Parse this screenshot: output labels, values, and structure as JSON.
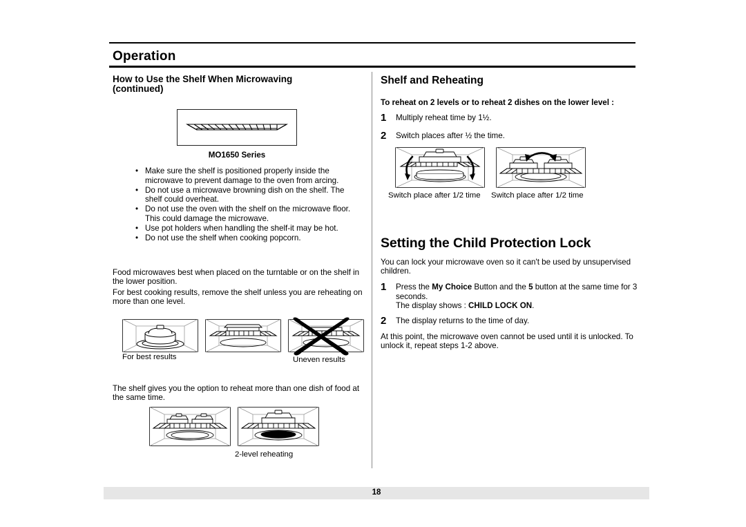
{
  "header": {
    "section_title": "Operation"
  },
  "left_column": {
    "heading_line1": "How to Use the Shelf When Microwaving",
    "heading_line2": "(continued)",
    "figure_shelf_caption": "MO1650 Series",
    "bullet_marker": "•",
    "bullets": [
      "Make sure the shelf is positioned properly inside the microwave to prevent damage to the oven from arcing.",
      "Do not use a microwave browning dish on the shelf. The shelf could overheat.",
      "Do not use the oven with the shelf on the microwave floor. This could damage the microwave.",
      "Use pot holders when handling the shelf-it may be hot.",
      "Do not use the shelf when cooking popcorn."
    ],
    "paragraph_1": "Food microwaves best when placed on the turntable or on the shelf in the lower position.",
    "paragraph_2": "For best cooking results, remove the shelf unless you are reheating on more than one level.",
    "caption_best_results": "For best results",
    "caption_uneven_results": "Uneven results",
    "paragraph_3": "The shelf gives you the option to reheat more than one dish of food at the same time.",
    "caption_two_level": "2-level reheating"
  },
  "right_column": {
    "heading_shelf_reheating": "Shelf and Reheating",
    "subheading": "To reheat on 2 levels or to reheat 2 dishes on the lower level :",
    "steps": [
      {
        "number": "1",
        "text": "Multiply reheat time by 1½."
      },
      {
        "number": "2",
        "text": "Switch places after ½ the time."
      }
    ],
    "caption_switch_left": "Switch place after 1/2 time",
    "caption_switch_right": "Switch place after 1/2 time",
    "heading_child_lock": "Setting the Child Protection Lock",
    "lock_intro": "You can lock your microwave oven so it can't be used by unsupervised children.",
    "lock_step1_number": "1",
    "lock_step1_part1": "Press the ",
    "lock_step1_bold1": "My Choice",
    "lock_step1_part2": " Button and  the ",
    "lock_step1_bold2": "5",
    "lock_step1_part3": " button at the same time for 3 seconds.",
    "lock_step1_line2_part1": "The display shows : ",
    "lock_step1_line2_bold": "CHILD LOCK ON",
    "lock_step1_line2_part2": ".",
    "lock_step2_number": "2",
    "lock_step2_text": "The display returns to the time of day.",
    "lock_outro": "At this point, the microwave oven cannot be used until it is unlocked. To unlock it, repeat steps 1-2 above."
  },
  "footer": {
    "page_number": "18"
  },
  "colors": {
    "text": "#000000",
    "rule": "#000000",
    "divider": "#8a8a8a",
    "footer_band": "#e6e6e6"
  }
}
